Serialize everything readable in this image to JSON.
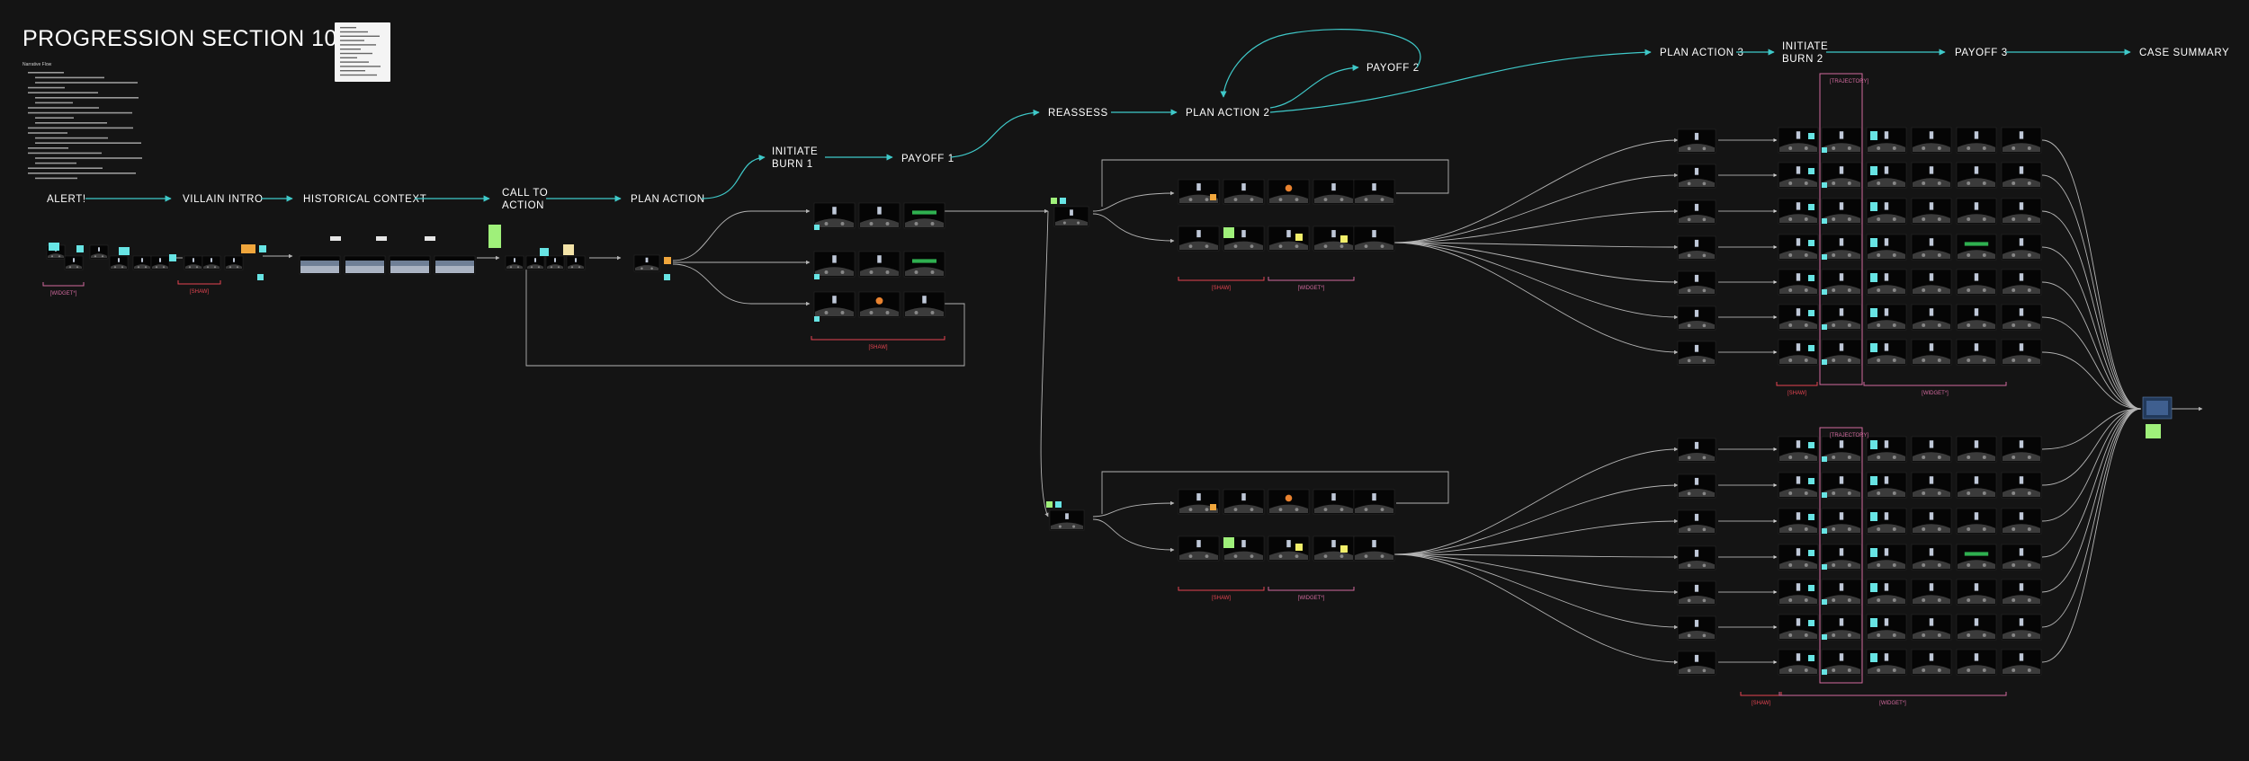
{
  "board": {
    "title": "PROGRESSION SECTION 10 V5",
    "notes_heading": "Narrative Flow",
    "notes_lines": 22,
    "sticky_lines": 6
  },
  "stages": {
    "alert": [
      "ALERT!"
    ],
    "villain_intro": [
      "VILLAIN INTRO"
    ],
    "historical_context": [
      "HISTORICAL CONTEXT"
    ],
    "call_to_action": [
      "CALL TO",
      "ACTION"
    ],
    "plan_action": [
      "PLAN ACTION"
    ],
    "initiate_burn_1": [
      "INITIATE",
      "BURN 1"
    ],
    "payoff_1": [
      "PAYOFF 1"
    ],
    "reassess": [
      "REASSESS"
    ],
    "plan_action_2": [
      "PLAN ACTION 2"
    ],
    "payoff_2": [
      "PAYOFF 2"
    ],
    "plan_action_3": [
      "PLAN ACTION 3"
    ],
    "initiate_burn_2": [
      "INITIATE",
      "BURN 2"
    ],
    "payoff_3": [
      "PAYOFF 3"
    ],
    "case_summary": [
      "CASE SUMMARY"
    ]
  },
  "brackets": {
    "widget": "[WIDGET*]",
    "shaw": "[SHAW]",
    "pink_box_header": "[TRAJECTORY]"
  },
  "colors": {
    "background": "#141414",
    "arrow_teal": "#3fc9c9",
    "connector_white": "#cfcfcf",
    "bracket_red": "#e64552",
    "bracket_pink": "#d26a9e",
    "sticky_cyan": "#67e4e4",
    "sticky_green": "#9ff07a",
    "sticky_yellow": "#f2ef6a",
    "sticky_orange": "#f0a63c",
    "sticky_beige": "#f3e3a7"
  },
  "icons": {
    "arrowhead": "arrowhead-icon",
    "sticky_note": "sticky-note-icon",
    "thumbnail": "screen-thumbnail-icon"
  }
}
